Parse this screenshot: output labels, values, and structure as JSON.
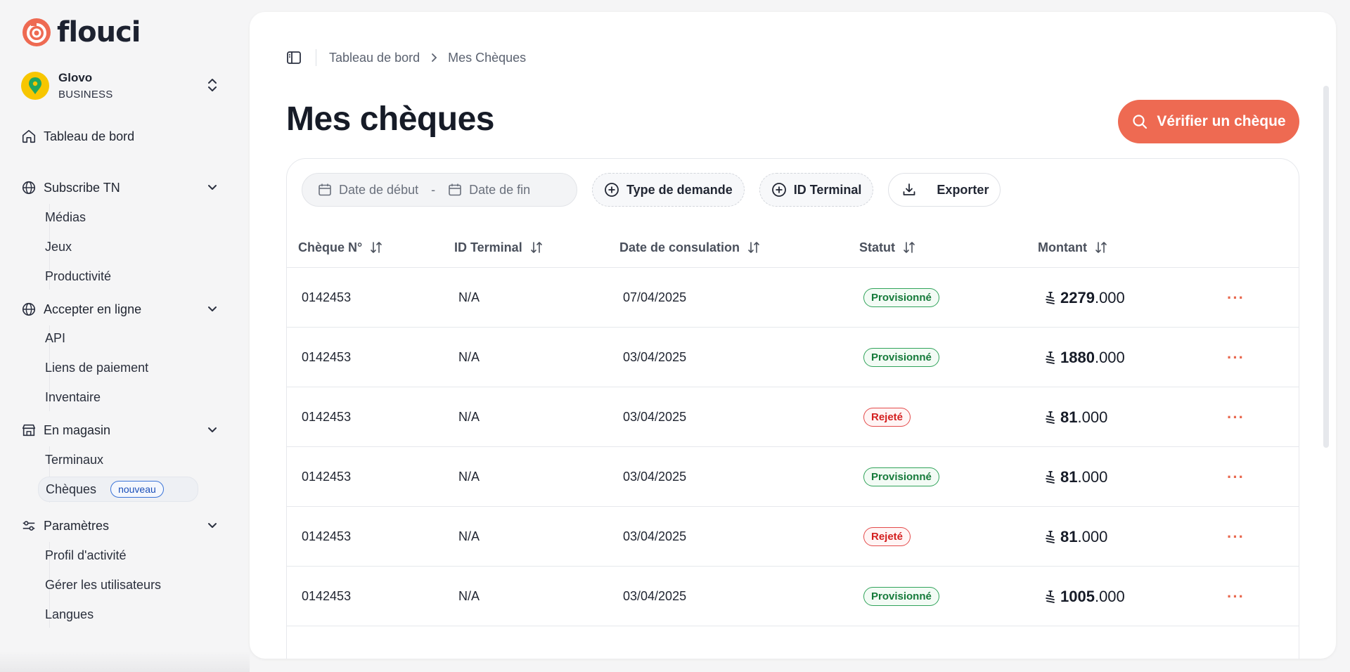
{
  "brand": {
    "name": "flouci",
    "accent": "#ee6a52"
  },
  "account": {
    "name": "Glovo",
    "type": "BUSINESS"
  },
  "sidebar": {
    "dashboard": "Tableau de bord",
    "sections": [
      {
        "label": "Subscribe TN",
        "icon": "globe-icon",
        "items": [
          "Médias",
          "Jeux",
          "Productivité"
        ]
      },
      {
        "label": "Accepter en ligne",
        "icon": "globe-icon",
        "items": [
          "API",
          "Liens de paiement",
          "Inventaire"
        ]
      },
      {
        "label": "En magasin",
        "icon": "store-icon",
        "items": [
          "Terminaux",
          "Chèques"
        ]
      },
      {
        "label": "Paramètres",
        "icon": "settings-sliders-icon",
        "items": [
          "Profil d'activité",
          "Gérer les utilisateurs",
          "Langues"
        ]
      }
    ],
    "new_badge": "nouveau"
  },
  "breadcrumb": {
    "root": "Tableau de bord",
    "current": "Mes Chèques"
  },
  "page": {
    "title": "Mes chèques",
    "verify_button": "Vérifier un chèque"
  },
  "filters": {
    "date_start": "Date de début",
    "date_sep": "-",
    "date_end": "Date de fin",
    "request_type": "Type de demande",
    "terminal_id": "ID Terminal",
    "export": "Exporter"
  },
  "table": {
    "columns": [
      "Chèque N°",
      "ID Terminal",
      "Date de consulation",
      "Statut",
      "Montant"
    ],
    "rows": [
      {
        "cheque": "0142453",
        "terminal": "N/A",
        "date": "07/04/2025",
        "status": "Provisionné",
        "ok": true,
        "amount_int": "2279",
        "amount_dec": ".000"
      },
      {
        "cheque": "0142453",
        "terminal": "N/A",
        "date": "03/04/2025",
        "status": "Provisionné",
        "ok": true,
        "amount_int": "1880",
        "amount_dec": ".000"
      },
      {
        "cheque": "0142453",
        "terminal": "N/A",
        "date": "03/04/2025",
        "status": "Rejeté",
        "ok": false,
        "amount_int": "81",
        "amount_dec": ".000"
      },
      {
        "cheque": "0142453",
        "terminal": "N/A",
        "date": "03/04/2025",
        "status": "Provisionné",
        "ok": true,
        "amount_int": "81",
        "amount_dec": ".000"
      },
      {
        "cheque": "0142453",
        "terminal": "N/A",
        "date": "03/04/2025",
        "status": "Rejeté",
        "ok": false,
        "amount_int": "81",
        "amount_dec": ".000"
      },
      {
        "cheque": "0142453",
        "terminal": "N/A",
        "date": "03/04/2025",
        "status": "Provisionné",
        "ok": true,
        "amount_int": "1005",
        "amount_dec": ".000"
      }
    ],
    "row_menu": "···"
  }
}
